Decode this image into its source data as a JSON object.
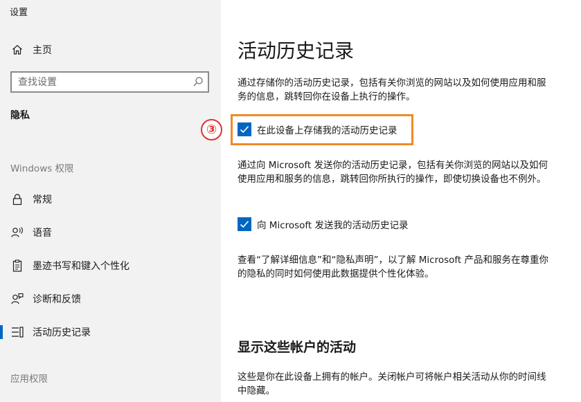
{
  "app": {
    "title": "设置"
  },
  "sidebar": {
    "home_label": "主页",
    "search_placeholder": "查找设置",
    "section_privacy": "隐私",
    "section_windows": "Windows 权限",
    "items": [
      {
        "label": "常规",
        "icon": "lock-icon"
      },
      {
        "label": "语音",
        "icon": "speech-icon"
      },
      {
        "label": "墨迹书写和键入个性化",
        "icon": "clipboard-icon"
      },
      {
        "label": "诊断和反馈",
        "icon": "feedback-icon"
      },
      {
        "label": "活动历史记录",
        "icon": "activity-history-icon",
        "active": true
      }
    ],
    "section_app": "应用权限"
  },
  "main": {
    "title": "活动历史记录",
    "para1": "通过存储你的活动历史记录，包括有关你浏览的网站以及如何使用应用和服务的信息，跳转回你在设备上执行的操作。",
    "checkbox1_label": "在此设备上存储我的活动历史记录",
    "checkbox1_checked": true,
    "para2": "通过向 Microsoft 发送你的活动历史记录，包括有关你浏览的网站以及如何使用应用和服务的信息，跳转回你所执行的操作，即使切换设备也不例外。",
    "checkbox2_label": "向 Microsoft 发送我的活动历史记录",
    "checkbox2_checked": true,
    "para3": "查看“了解详细信息”和“隐私声明”，以了解 Microsoft 产品和服务在尊重你的隐私的同时如何使用此数据提供个性化体验。",
    "section2_title": "显示这些帐户的活动",
    "para4": "这些是你在此设备上拥有的帐户。关闭帐户可将帐户相关活动从你的时间线中隐藏。"
  },
  "annotation": {
    "step_marker": "③",
    "highlight_color": "#f08a24",
    "marker_color": "#e03131"
  },
  "colors": {
    "accent": "#0067c0",
    "sidebar_bg": "#f2f2f2"
  }
}
